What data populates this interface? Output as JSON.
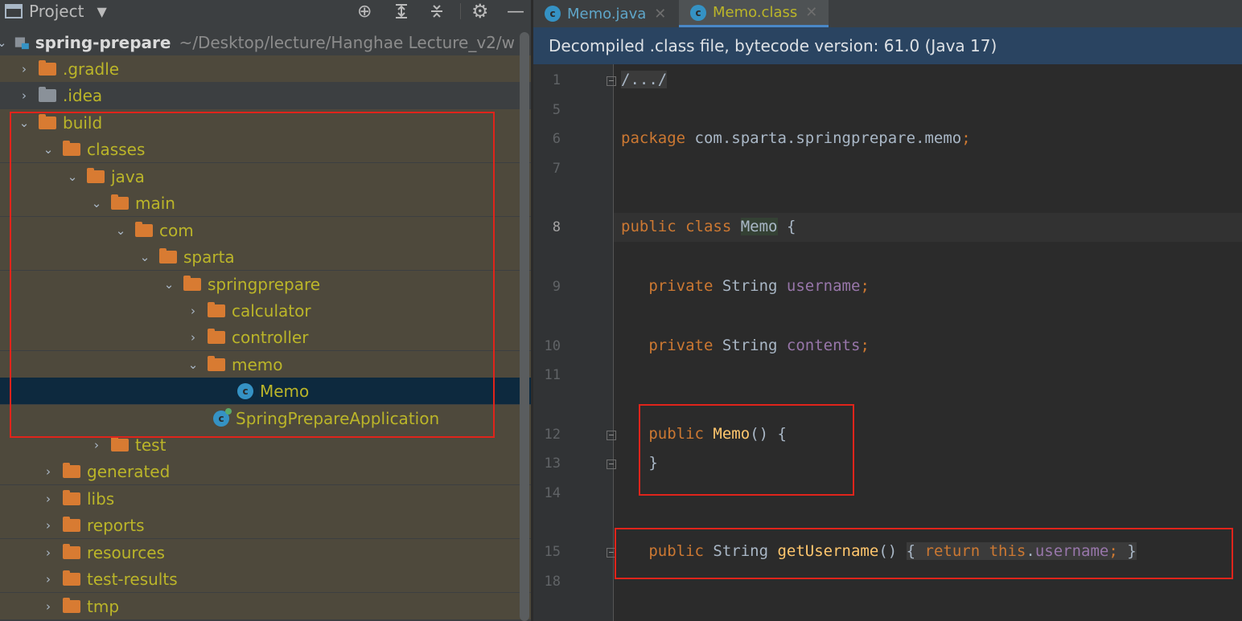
{
  "project_panel": {
    "header": {
      "title": "Project"
    },
    "root": {
      "name": "spring-prepare",
      "path": "~/Desktop/lecture/Hanghae Lecture_v2/w"
    },
    "tree": [
      {
        "label": ".gradle",
        "icon": "folder-icon",
        "state": "collapsed"
      },
      {
        "label": ".idea",
        "icon": "folder-icon",
        "state": "collapsed"
      },
      {
        "label": "build",
        "icon": "folder-icon",
        "state": "expanded"
      },
      {
        "label": "classes",
        "icon": "folder-icon",
        "state": "expanded"
      },
      {
        "label": "java",
        "icon": "folder-icon",
        "state": "expanded"
      },
      {
        "label": "main",
        "icon": "folder-icon",
        "state": "expanded"
      },
      {
        "label": "com",
        "icon": "folder-icon",
        "state": "expanded"
      },
      {
        "label": "sparta",
        "icon": "folder-icon",
        "state": "expanded"
      },
      {
        "label": "springprepare",
        "icon": "folder-icon",
        "state": "expanded"
      },
      {
        "label": "calculator",
        "icon": "folder-icon",
        "state": "collapsed"
      },
      {
        "label": "controller",
        "icon": "folder-icon",
        "state": "collapsed"
      },
      {
        "label": "memo",
        "icon": "folder-icon",
        "state": "expanded"
      },
      {
        "label": "Memo",
        "icon": "class-icon",
        "state": "selected"
      },
      {
        "label": "SpringPrepareApplication",
        "icon": "class-icon"
      },
      {
        "label": "test",
        "icon": "folder-icon",
        "state": "collapsed"
      },
      {
        "label": "generated",
        "icon": "folder-icon",
        "state": "collapsed"
      },
      {
        "label": "libs",
        "icon": "folder-icon",
        "state": "collapsed"
      },
      {
        "label": "reports",
        "icon": "folder-icon",
        "state": "collapsed"
      },
      {
        "label": "resources",
        "icon": "folder-icon",
        "state": "collapsed"
      },
      {
        "label": "test-results",
        "icon": "folder-icon",
        "state": "collapsed"
      },
      {
        "label": "tmp",
        "icon": "folder-icon",
        "state": "collapsed"
      }
    ]
  },
  "editor": {
    "tabs": [
      {
        "label": "Memo.java",
        "icon": "c"
      },
      {
        "label": "Memo.class",
        "icon": "c",
        "active": true
      }
    ],
    "banner": "Decompiled .class file, bytecode version: 61.0 (Java 17)",
    "line_numbers": [
      "1",
      "5",
      "6",
      "7",
      "8",
      "9",
      "10",
      "11",
      "12",
      "13",
      "14",
      "15",
      "18"
    ],
    "code": {
      "l1": "/.../",
      "l6_kw": "package",
      "l6_rest": " com.sparta.springprepare.memo",
      "l6_semi": ";",
      "l8_kw": "public class",
      "l8_name": "Memo",
      "l8_brace": " {",
      "l9_kw": "private",
      "l9_type": " String ",
      "l9_field": "username",
      "l9_semi": ";",
      "l10_kw": "private",
      "l10_type": " String ",
      "l10_field": "contents",
      "l10_semi": ";",
      "l12_kw": "public",
      "l12_name": "Memo",
      "l12_rest": "() {",
      "l13": "}",
      "l15_kw": "public",
      "l15_type": " String ",
      "l15_name": "getUsername",
      "l15_parens": "() ",
      "l15_open": "{ ",
      "l15_ret": "return this",
      "l15_dot": ".",
      "l15_field": "username",
      "l15_semi": ";",
      "l15_close": " }"
    }
  },
  "colors": {
    "folder": "#d87b32",
    "tree_text": "#bbb529",
    "annotation": "#e0241b",
    "keyword": "#cc7832",
    "field": "#9876aa",
    "function": "#ffc66d"
  }
}
